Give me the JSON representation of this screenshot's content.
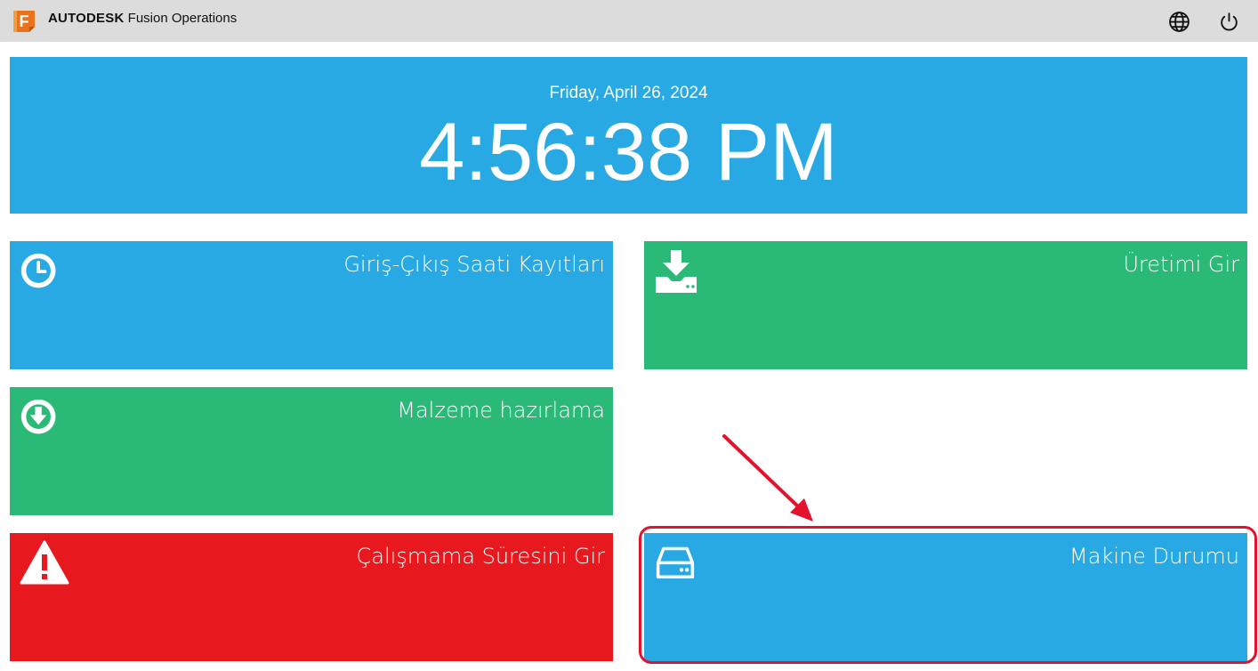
{
  "app": {
    "brand_primary": "AUTODESK",
    "brand_secondary": "Fusion Operations",
    "logo_letter": "F",
    "header_icons": [
      "globe-icon",
      "power-icon"
    ]
  },
  "clock": {
    "date": "Friday, April 26, 2024",
    "time": "4:56:38 PM"
  },
  "tiles": [
    {
      "label": "Giriş-Çıkış Saati Kayıtları",
      "icon": "clock-icon",
      "color": "#29a9e3"
    },
    {
      "label": "Üretimi Gir",
      "icon": "download-tray-icon",
      "color": "#2bb978"
    },
    {
      "label": "Malzeme hazırlama",
      "icon": "arrow-down-circle-icon",
      "color": "#2bb978"
    },
    {
      "label": "Çalışmama Süresini Gir",
      "icon": "warning-icon",
      "color": "#e8191e"
    },
    {
      "label": "Makine Durumu",
      "icon": "hard-drive-icon",
      "color": "#29a9e3"
    }
  ],
  "annotation": {
    "highlight_color": "#e3132d",
    "highlighted_tile": "Makine Durumu"
  }
}
